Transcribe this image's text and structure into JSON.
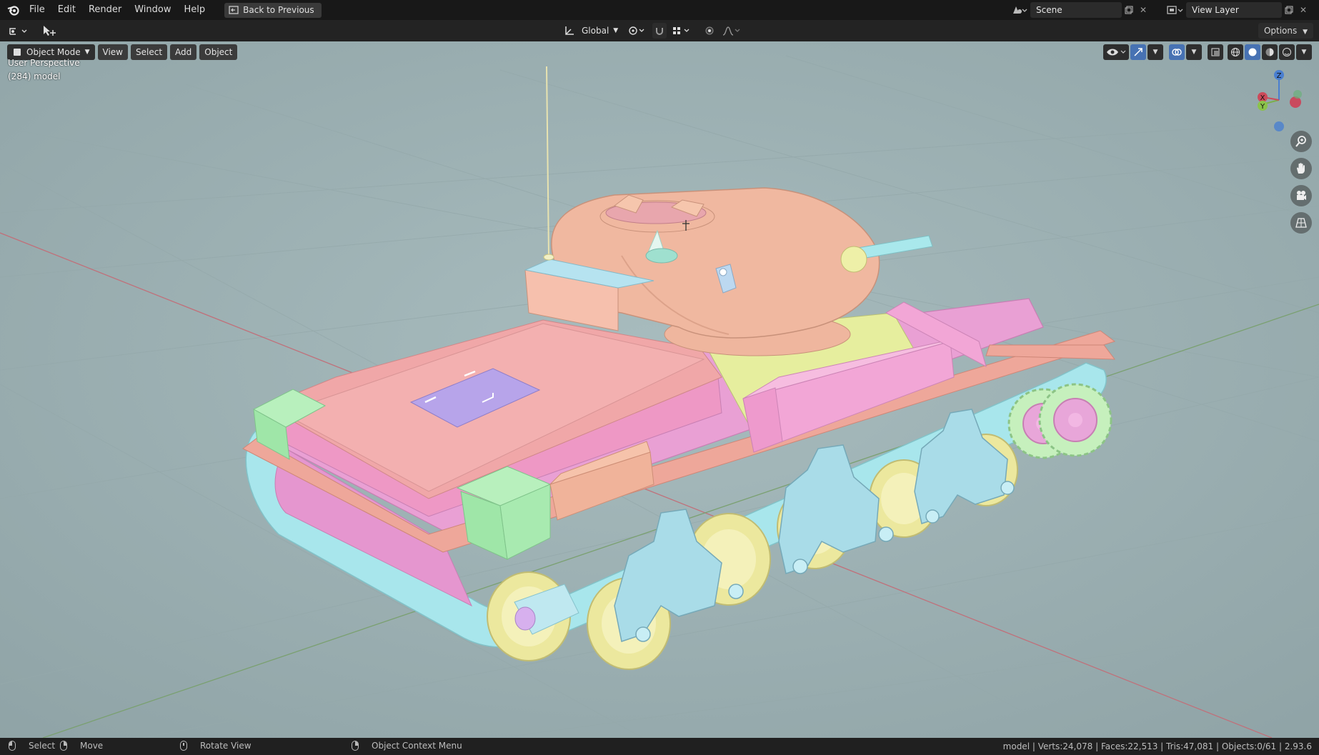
{
  "menu": {
    "items": [
      "File",
      "Edit",
      "Render",
      "Window",
      "Help"
    ],
    "back_label": "Back to Previous"
  },
  "scene": {
    "name": "Scene",
    "view_layer": "View Layer"
  },
  "header": {
    "orientation": "Global",
    "options_label": "Options"
  },
  "viewport": {
    "mode": "Object Mode",
    "menus": [
      "View",
      "Select",
      "Add",
      "Object"
    ],
    "perspective": "User Perspective",
    "object_info": "(284) model",
    "background_color": "#9fb3b5"
  },
  "gizmo": {
    "z": "Z",
    "x": "X",
    "y": "Y"
  },
  "statusbar": {
    "select": "Select",
    "move": "Move",
    "rotate": "Rotate View",
    "context": "Object Context Menu",
    "stats": "model | Verts:24,078 | Faces:22,513 | Tris:47,081 | Objects:0/61 | 2.93.6"
  },
  "colors": {
    "hull": "#e9a0d4",
    "deck": "#eea79a",
    "turret": "#f0b8a0",
    "tracks": "#a8e6ec",
    "wheels": "#ece89e",
    "boxes": "#9fe6a8",
    "accent": "#4772b3"
  }
}
